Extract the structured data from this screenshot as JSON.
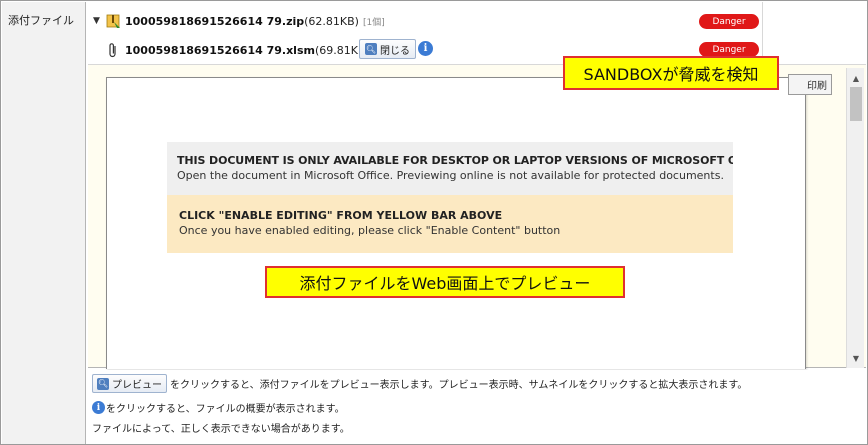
{
  "label": "添付ファイル",
  "attachments": [
    {
      "name": "100059818691526614 79.zip",
      "size": "(62.81KB)",
      "count": "[1個]",
      "status": "Danger"
    },
    {
      "name": "100059818691526614 79.xlsm",
      "size": "(69.81KB)",
      "status": "Danger",
      "close_label": "閉じる"
    }
  ],
  "preview": {
    "print_label": "印刷",
    "doc": {
      "warning_title": "THIS DOCUMENT IS ONLY AVAILABLE FOR DESKTOP OR LAPTOP VERSIONS OF MICROSOFT OFFICE",
      "warning_text": "Open the document in Microsoft Office. Previewing online is not available for protected documents.",
      "instruction_title": "CLICK \"ENABLE EDITING\" FROM YELLOW BAR ABOVE",
      "instruction_text": "Once you have enabled editing, please click \"Enable Content\" button"
    }
  },
  "callouts": {
    "sandbox": "SANDBOXが脅威を検知",
    "preview": "添付ファイルをWeb画面上でプレビュー"
  },
  "footer": {
    "preview_button": "プレビュー",
    "line1_text": "をクリックすると、添付ファイルをプレビュー表示します。プレビュー表示時、サムネイルをクリックすると拡大表示されます。",
    "line2_text": "をクリックすると、ファイルの概要が表示されます。",
    "line3_text": "ファイルによって、正しく表示できない場合があります。"
  },
  "colors": {
    "danger": "#e01818",
    "callout_fill": "#ffff00",
    "callout_border": "#e03030",
    "info": "#3b7bd4"
  },
  "icons": {
    "expand": "triangle-down-icon",
    "zip": "zip-archive-icon",
    "clip": "paperclip-icon",
    "search": "magnifier-icon",
    "info": "info-icon"
  }
}
